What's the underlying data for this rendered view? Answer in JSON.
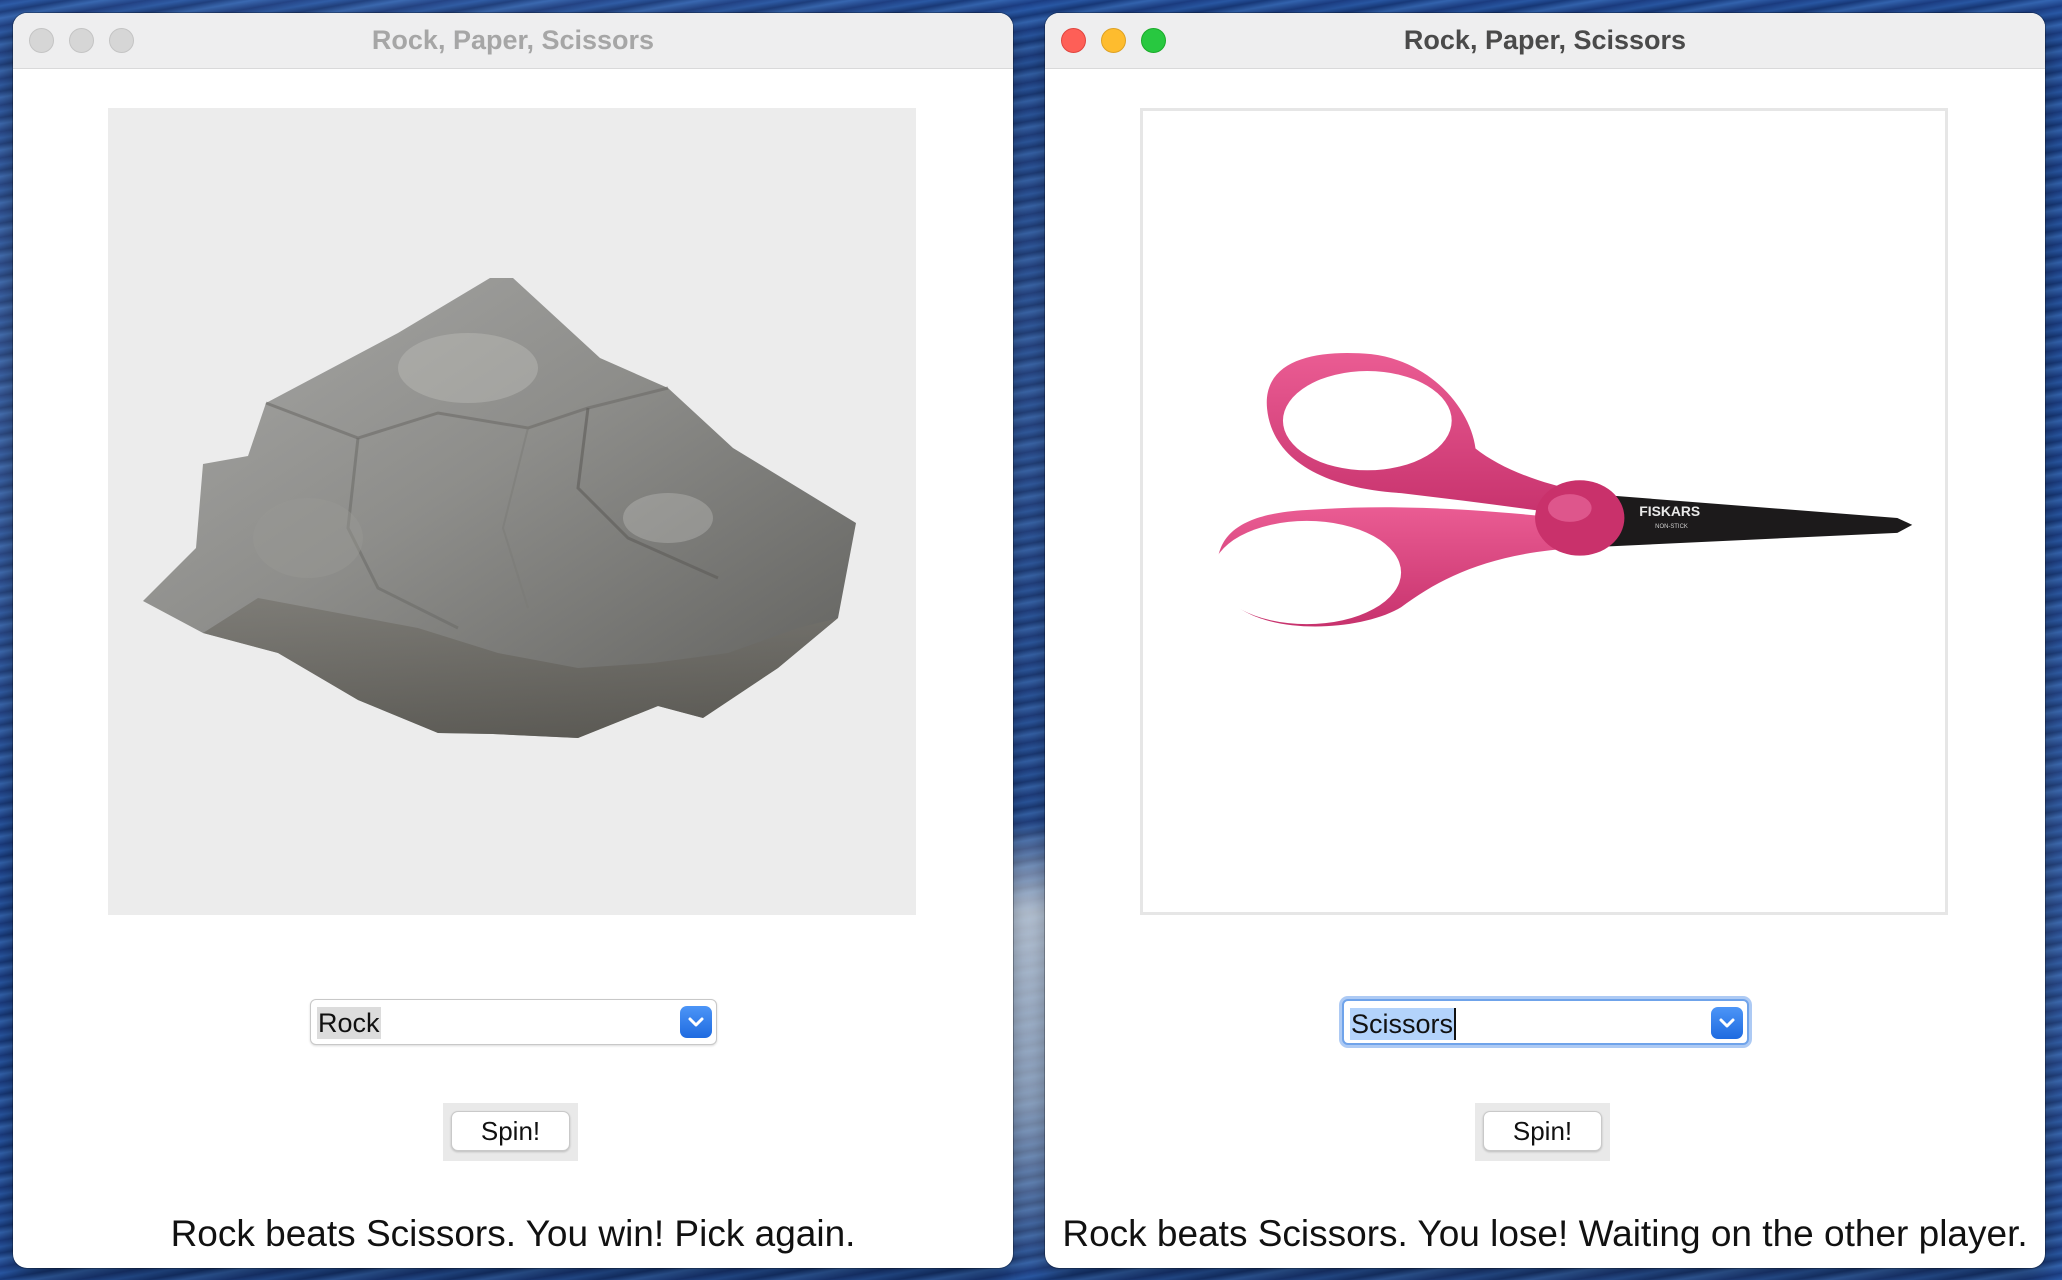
{
  "left_window": {
    "title": "Rock, Paper, Scissors",
    "image_subject": "rock",
    "choice": {
      "selected": "Rock"
    },
    "spin_label": "Spin!",
    "status": "Rock beats Scissors. You win! Pick again."
  },
  "right_window": {
    "title": "Rock, Paper, Scissors",
    "image_subject": "scissors",
    "choice": {
      "selected": "Scissors"
    },
    "spin_label": "Spin!",
    "status": "Rock beats Scissors. You lose! Waiting on the other player.",
    "scissors_brand": "FISKARS",
    "scissors_subtext": "NON-STICK"
  },
  "colors": {
    "accent": "#1f6be0",
    "close": "#fe5f57",
    "minimize": "#febc2e",
    "zoom": "#28c840",
    "scissors_handle": "#e0457f"
  },
  "icons": [
    "close-icon",
    "minimize-icon",
    "zoom-icon",
    "chevron-down-icon"
  ]
}
